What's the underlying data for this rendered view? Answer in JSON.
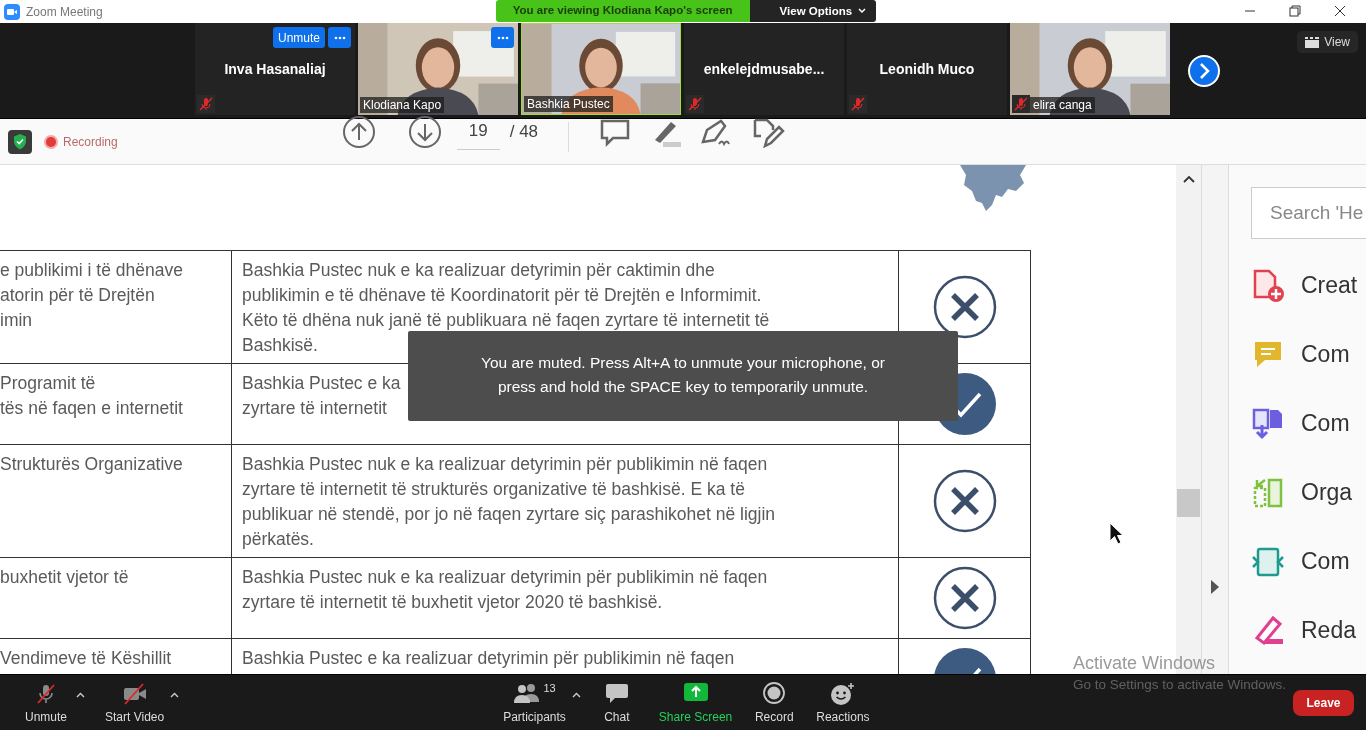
{
  "window": {
    "title": "Zoom Meeting",
    "share_banner": "You are viewing Klodiana Kapo's screen",
    "view_options": "View Options"
  },
  "participants": [
    {
      "name": "Inva Hasanaliaj",
      "kind": "avatar",
      "muted": true,
      "active": false,
      "more": true,
      "unmute": "Unmute"
    },
    {
      "name": "Klodiana Kapo",
      "kind": "video",
      "muted": false,
      "active": false,
      "more": true
    },
    {
      "name": "Bashkia Pustec",
      "kind": "video",
      "muted": false,
      "active": true,
      "more": false
    },
    {
      "name": "enkelejdmusabe...",
      "kind": "avatar",
      "muted": true,
      "active": false,
      "more": false
    },
    {
      "name": "Leonidh Muco",
      "kind": "avatar",
      "muted": true,
      "active": false,
      "more": false
    },
    {
      "name": "elira canga",
      "kind": "video",
      "muted": true,
      "active": false,
      "more": false
    }
  ],
  "view_button": "View",
  "acrobat": {
    "recording": "Recording",
    "page": "19",
    "page_total": "/ 48",
    "table": {
      "rows": [
        {
          "col1": [
            "e publikimi i të dhënave",
            "atorin për të Drejtën",
            "imin"
          ],
          "col2": [
            "Bashkia Pustec nuk e ka realizuar detyrimin për caktimin dhe",
            "publikimin e të dhënave të Koordinatorit për të Drejtën e Informimit.",
            "Këto të dhëna nuk janë të publikuara në faqen zyrtare të internetit të",
            "Bashkisë."
          ],
          "kind": "cross"
        },
        {
          "col1": [
            "Programit të",
            "tës në faqen e internetit"
          ],
          "col2": [
            "Bashkia Pustec e ka",
            "zyrtare të internetit"
          ],
          "kind": "check"
        },
        {
          "col1": [
            "Strukturës Organizative"
          ],
          "col2": [
            "Bashkia Pustec nuk e ka realizuar detyrimin për publikimin në faqen",
            "zyrtare të internetit të strukturës organizative të bashkisë. E ka të",
            "publikuar në stendë, por jo në faqen zyrtare siç parashikohet në ligjin",
            "përkatës."
          ],
          "kind": "cross"
        },
        {
          "col1": [
            "buxhetit vjetor të"
          ],
          "col2": [
            "Bashkia Pustec nuk e ka realizuar detyrimin për publikimin në faqen",
            "zyrtare të internetit të buxhetit vjetor 2020 të bashkisë."
          ],
          "kind": "cross"
        },
        {
          "col1": [
            "Vendimeve të Këshillit"
          ],
          "col2": [
            "Bashkia Pustec e ka realizuar detyrimin për publikimin në faqen"
          ],
          "kind": "check"
        }
      ]
    },
    "search_placeholder": "Search 'He",
    "tools": [
      {
        "label": "Creat",
        "kind": "create"
      },
      {
        "label": "Com",
        "kind": "comment"
      },
      {
        "label": "Com",
        "kind": "combine"
      },
      {
        "label": "Orga",
        "kind": "organize"
      },
      {
        "label": "Com",
        "kind": "compress"
      },
      {
        "label": "Reda",
        "kind": "redact"
      }
    ]
  },
  "toast": [
    "You are muted. Press Alt+A to unmute your microphone, or",
    "press and hold the SPACE key to temporarily unmute."
  ],
  "activation": {
    "title": "Activate Windows",
    "subtitle": "Go to Settings to activate Windows."
  },
  "toolbar": {
    "items": [
      {
        "kind": "mic",
        "label": "Unmute",
        "caret": true
      },
      {
        "kind": "video",
        "label": "Start Video",
        "caret": true
      },
      {
        "kind": "participants",
        "label": "Participants",
        "count": "13",
        "caret": true
      },
      {
        "kind": "chat",
        "label": "Chat",
        "caret": false
      },
      {
        "kind": "share",
        "label": "Share Screen",
        "caret": false
      },
      {
        "kind": "record",
        "label": "Record",
        "caret": false
      },
      {
        "kind": "reactions",
        "label": "Reactions",
        "caret": false
      }
    ],
    "leave": "Leave"
  }
}
